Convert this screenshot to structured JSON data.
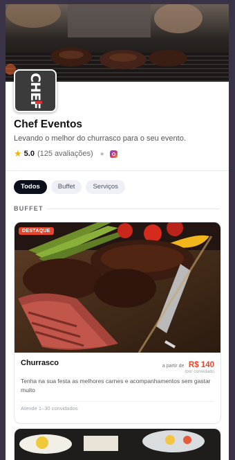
{
  "business": {
    "name": "Chef Eventos",
    "tagline": "Levando o melhor do churrasco para o seu evento.",
    "logo_text": "CHEF",
    "rating": "5.0",
    "reviews": "(125 avaliações)",
    "social_icon": "instagram-icon"
  },
  "tabs": [
    {
      "label": "Todos",
      "active": true
    },
    {
      "label": "Buffet",
      "active": false
    },
    {
      "label": "Serviços",
      "active": false
    }
  ],
  "section": {
    "label": "BUFFET"
  },
  "cards": [
    {
      "badge": "DESTAQUE",
      "title": "Churrasco",
      "price_prefix": "a partir de",
      "price": "R$ 140",
      "price_unit": "/por convidado",
      "description": "Tenha na sua festa as melhores carnes e acompanhamentos sem gastar muito",
      "capacity": "Atende 1–30 convidados"
    }
  ],
  "colors": {
    "accent": "#e7462b",
    "active_tab": "#0b0f1a",
    "star": "#f4b400"
  }
}
